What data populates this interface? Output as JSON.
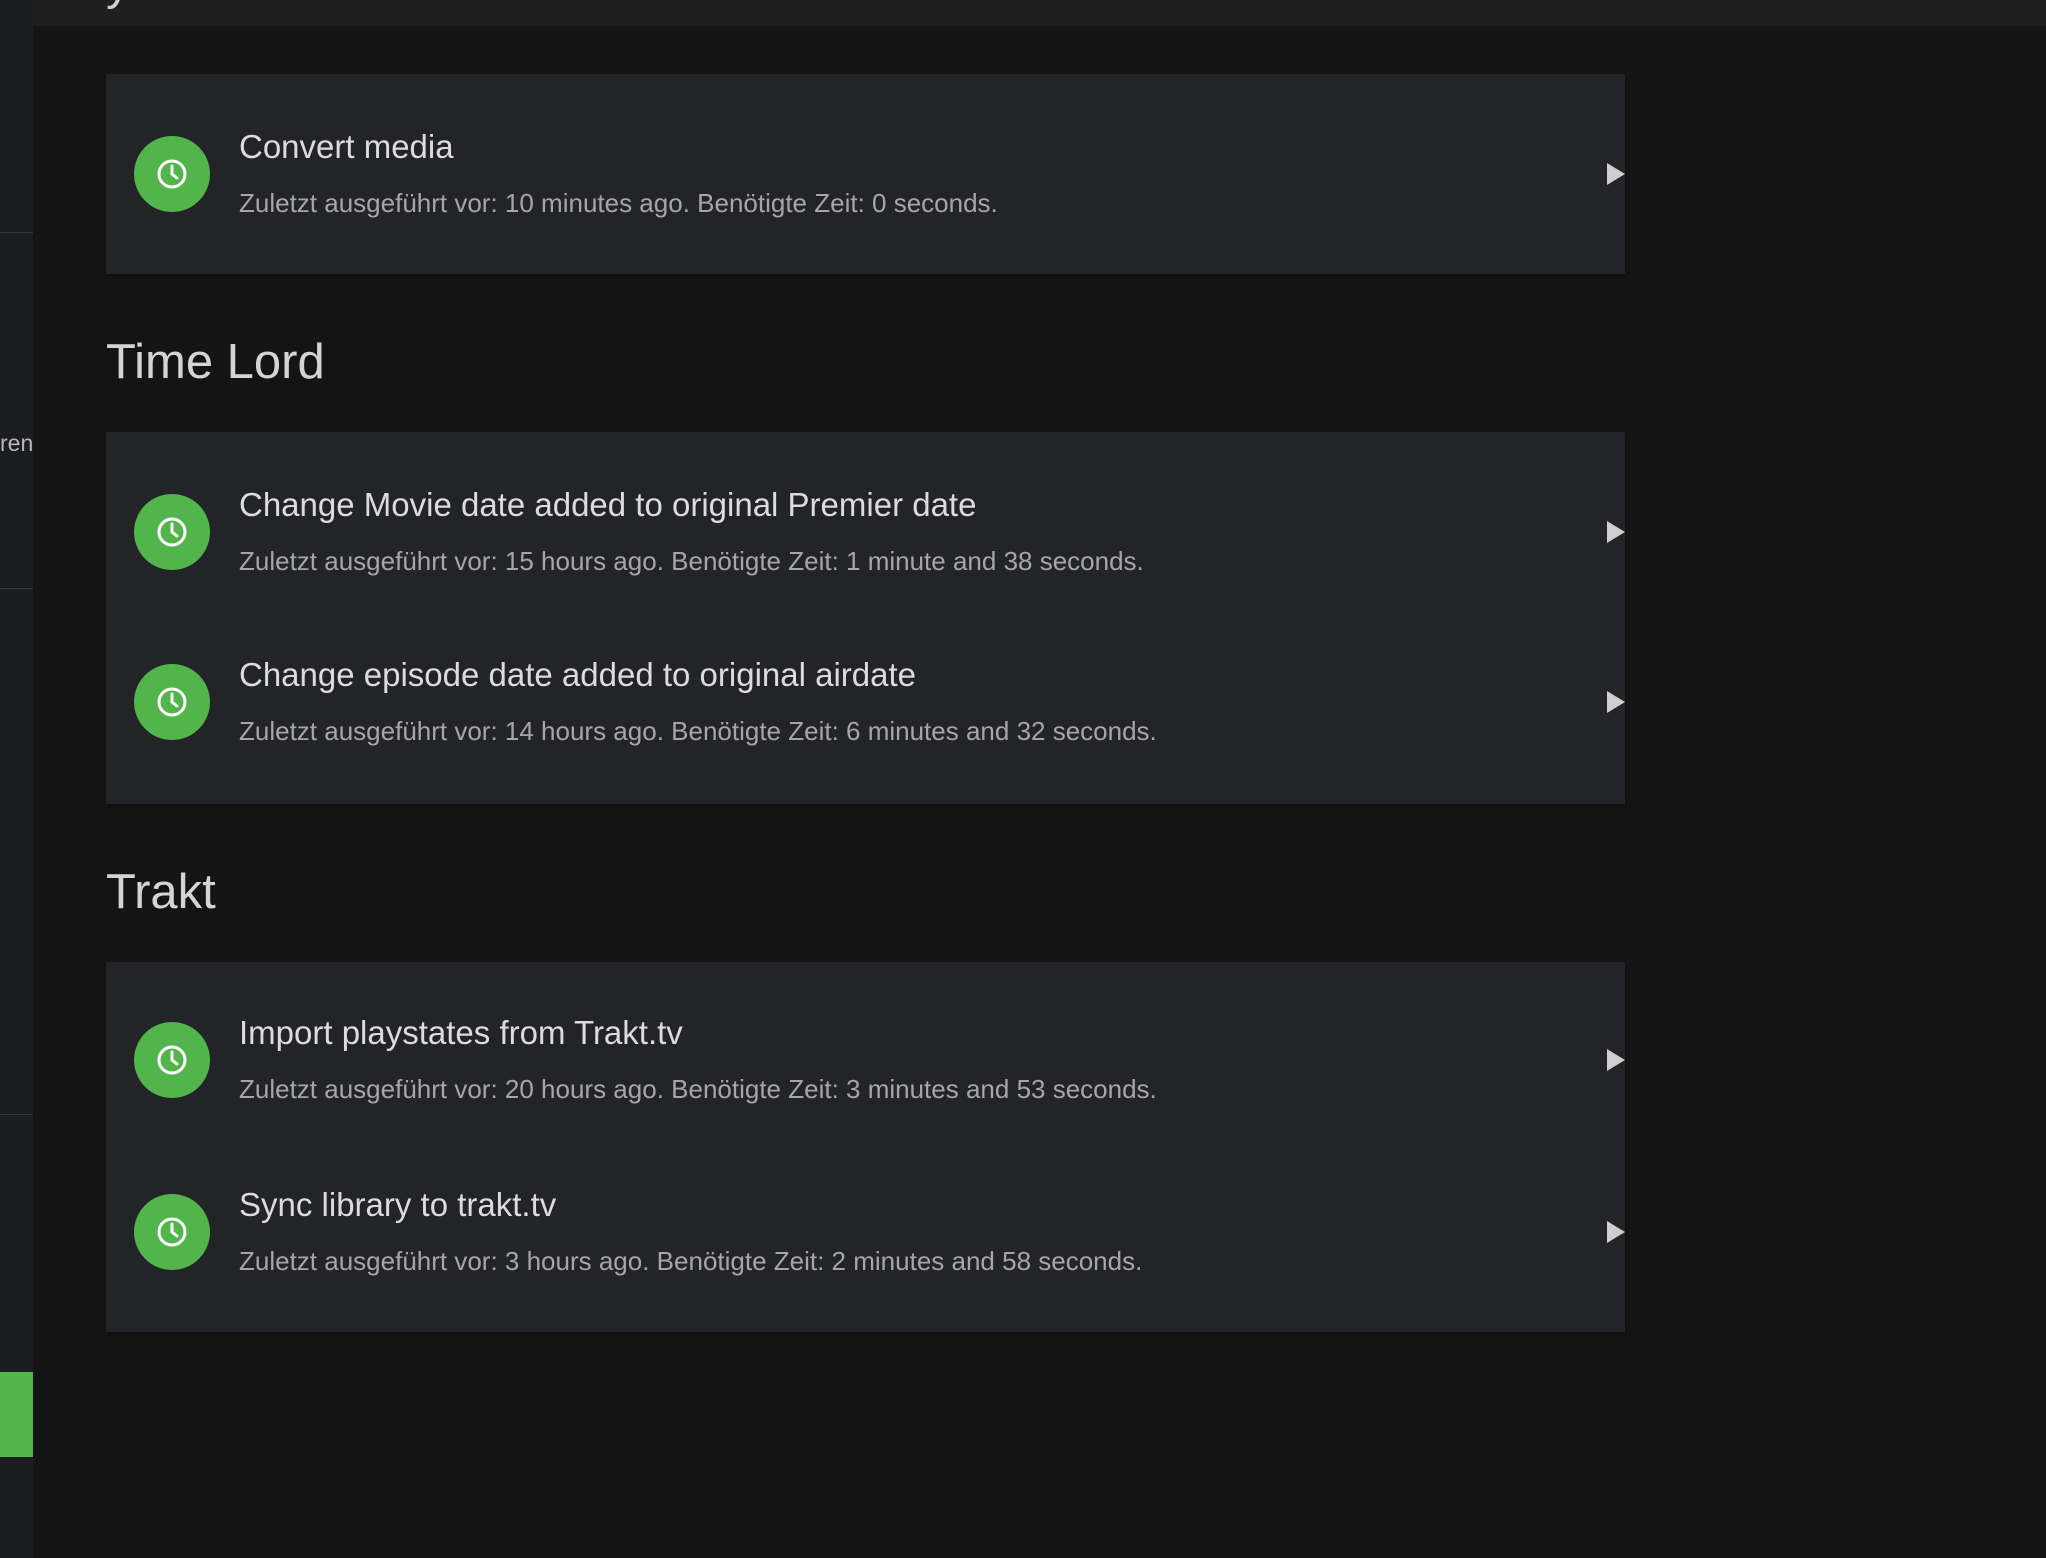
{
  "sidebar": {
    "fragment_text": "ren"
  },
  "partial_heading": "y",
  "sections": [
    {
      "title": "",
      "tasks": [
        {
          "name": "Convert media",
          "status": "Zuletzt ausgeführt vor: 10 minutes ago. Benötigte Zeit: 0 seconds."
        }
      ]
    },
    {
      "title": "Time Lord",
      "tasks": [
        {
          "name": "Change Movie date added to original Premier date",
          "status": "Zuletzt ausgeführt vor: 15 hours ago. Benötigte Zeit: 1 minute and 38 seconds."
        },
        {
          "name": "Change episode date added to original airdate",
          "status": "Zuletzt ausgeführt vor: 14 hours ago. Benötigte Zeit: 6 minutes and 32 seconds."
        }
      ]
    },
    {
      "title": "Trakt",
      "tasks": [
        {
          "name": "Import playstates from Trakt.tv",
          "status": "Zuletzt ausgeführt vor: 20 hours ago. Benötigte Zeit: 3 minutes and 53 seconds."
        },
        {
          "name": "Sync library to trakt.tv",
          "status": "Zuletzt ausgeführt vor: 3 hours ago. Benötigte Zeit: 2 minutes and 58 seconds."
        }
      ]
    }
  ],
  "colors": {
    "accent": "#52b54b",
    "card": "#232428",
    "background": "#141414"
  },
  "icons": {
    "task_icon": "clock-icon",
    "action_icon": "play-icon"
  }
}
